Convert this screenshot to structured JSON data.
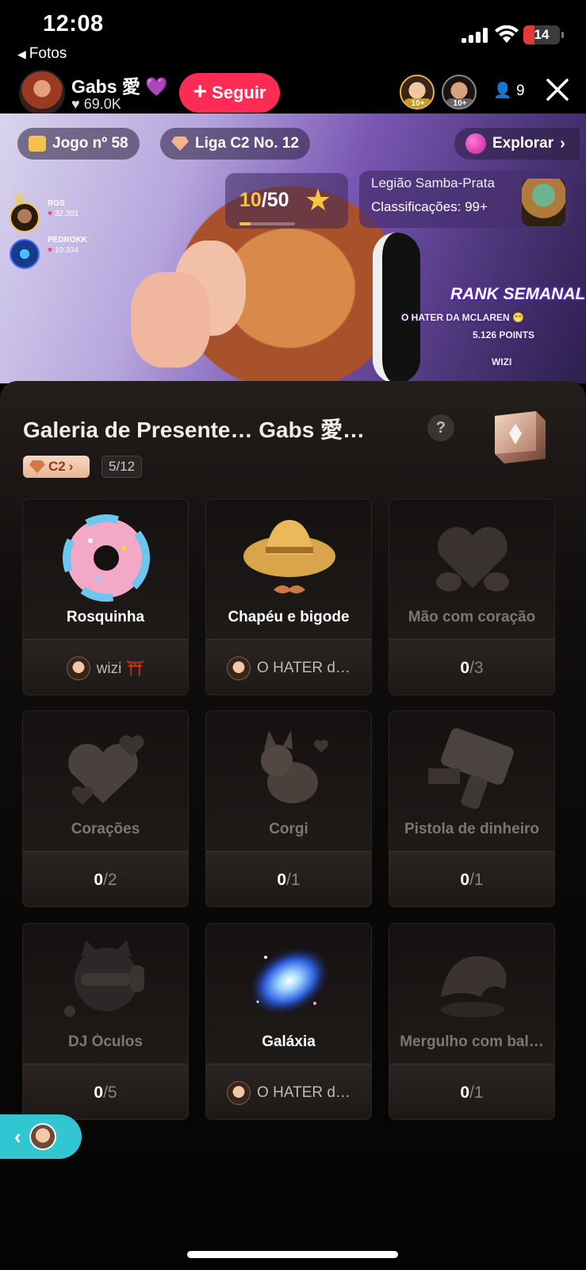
{
  "status_bar": {
    "time": "12:08",
    "back_app": "Fotos",
    "battery": "14"
  },
  "host": {
    "name": "Gabs 愛 💜",
    "likes": "69.0K",
    "follow_label": "Seguir",
    "viewer_count": "9",
    "viewer_badges": [
      "10+",
      "10+"
    ]
  },
  "video": {
    "game_pill": "Jogo nº 58",
    "league_pill": "Liga C2 No. 12",
    "explore_pill": "Explorar",
    "stars": {
      "current": "10",
      "total": "/50",
      "progress": 0.2
    },
    "legion": {
      "title": "Legião Samba-Prata",
      "rank": "Classificações: 99+"
    },
    "top_gifters": [
      {
        "name": "RGS",
        "score": "32.301"
      },
      {
        "name": "PEDROKK",
        "score": "10.334"
      }
    ],
    "rank_overlay": {
      "title": "RANK SEMANAL",
      "line1": "O HATER DA MCLAREN 😁",
      "line2": "5.126 POINTS",
      "line3": "WIZI"
    }
  },
  "gallery": {
    "title": "Galeria de Presente… Gabs 愛…",
    "help": "?",
    "badge": "C2",
    "progress": "5/12",
    "gifts": [
      {
        "name": "Rosquinha",
        "state": "unlocked",
        "top_user": "wizi ⛩️",
        "art": "donut-icon"
      },
      {
        "name": "Chapéu e bigode",
        "state": "unlocked",
        "top_user": "O HATER d…",
        "art": "hat-mustache-icon"
      },
      {
        "name": "Mão com coração",
        "state": "locked",
        "have": "0",
        "need": "/3",
        "art": "hand-heart-icon"
      },
      {
        "name": "Corações",
        "state": "locked",
        "have": "0",
        "need": "/2",
        "art": "hearts-icon"
      },
      {
        "name": "Corgi",
        "state": "locked",
        "have": "0",
        "need": "/1",
        "art": "corgi-icon"
      },
      {
        "name": "Pistola de dinheiro",
        "state": "locked",
        "have": "0",
        "need": "/1",
        "art": "money-gun-icon"
      },
      {
        "name": "DJ Óculos",
        "state": "locked",
        "have": "0",
        "need": "/5",
        "art": "dj-glasses-icon"
      },
      {
        "name": "Galáxia",
        "state": "unlocked",
        "top_user": "O HATER d…",
        "art": "galaxy-icon"
      },
      {
        "name": "Mergulho com bal…",
        "state": "locked",
        "have": "0",
        "need": "/1",
        "art": "whale-dive-icon"
      }
    ]
  },
  "colors": {
    "follow": "#fe2c55",
    "accent_gold": "#f6c342",
    "float_button": "#32c5d2"
  }
}
